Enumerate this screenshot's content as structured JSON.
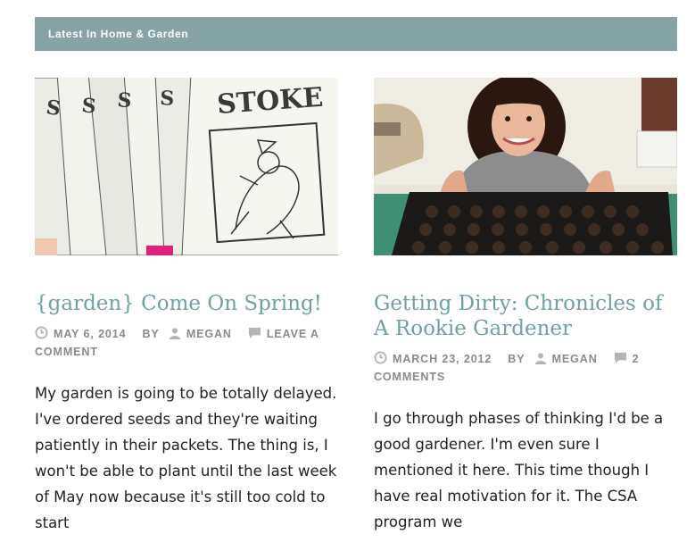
{
  "section": {
    "title": "Latest In Home & Garden"
  },
  "posts": [
    {
      "title": "{garden} Come On Spring!",
      "date": "May 6, 2014",
      "by_label": "By",
      "author": "Megan",
      "comments": "Leave a comment",
      "excerpt": "My garden is going to be totally delayed. I've ordered seeds and they're waiting patiently in their packets. The thing is, I won't be able to plant until the last week of May now because it's still too cold to start",
      "image_alt": "seed packets"
    },
    {
      "title": "Getting Dirty: Chronicles of A Rookie Gardener",
      "date": "March 23, 2012",
      "by_label": "By",
      "author": "Megan",
      "comments": "2 comments",
      "excerpt": "I go through phases of thinking I'd be a good gardener. I'm even sure I mentioned it here. This time though I have real motivation for it. The CSA program we",
      "image_alt": "woman holding seedling tray"
    }
  ],
  "colors": {
    "accent": "#86a3a5",
    "title": "#6fa1a2",
    "meta": "#8a8a8a"
  }
}
